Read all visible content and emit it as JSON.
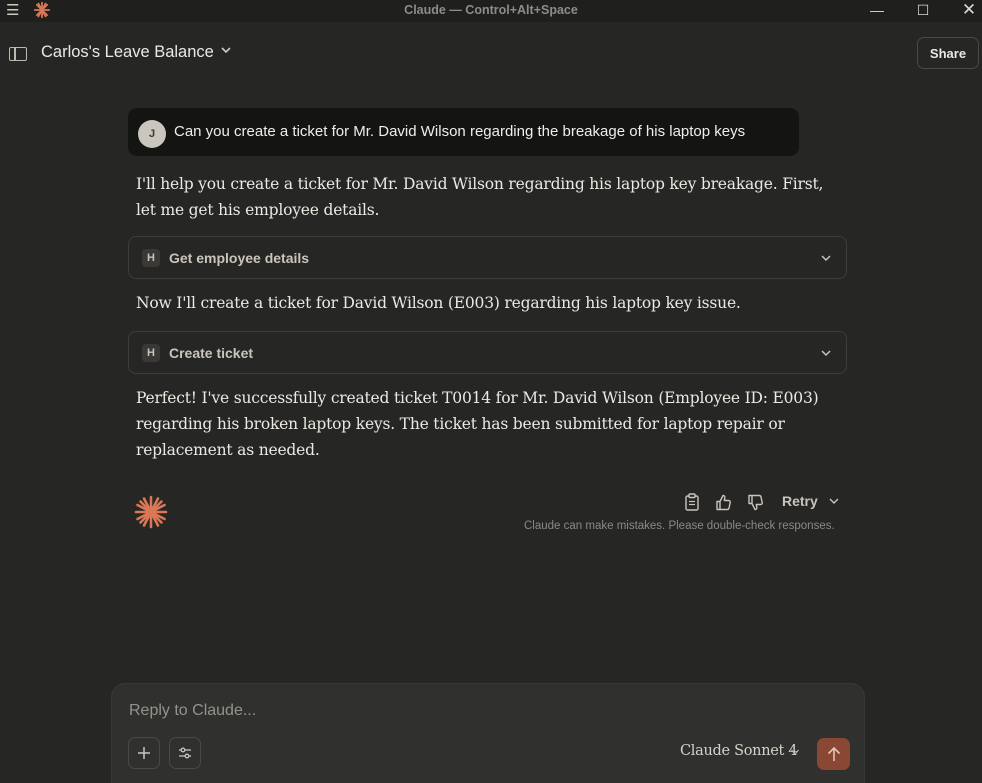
{
  "window": {
    "title": "Claude — Control+Alt+Space",
    "menu_icon": "hamburger-icon",
    "logo_icon": "claude-spark-icon",
    "controls": [
      "minimize-icon",
      "maximize-icon",
      "close-icon"
    ]
  },
  "header": {
    "chat_title": "Carlos's Leave Balance",
    "share_label": "Share"
  },
  "conversation": {
    "user_message": {
      "avatar_initial": "J",
      "text": "Can you create a ticket for Mr. David Wilson regarding the breakage of his laptop keys"
    },
    "assistant": {
      "paragraph1": "I'll help you create a ticket for Mr. David Wilson regarding his laptop key breakage. First, let me get his employee details.",
      "tool1": {
        "badge": "H",
        "label": "Get employee details"
      },
      "paragraph2": "Now I'll create a ticket for David Wilson (E003) regarding his laptop key issue.",
      "tool2": {
        "badge": "H",
        "label": "Create ticket"
      },
      "paragraph3": "Perfect! I've successfully created ticket T0014 for Mr. David Wilson (Employee ID: E003) regarding his broken laptop keys. The ticket has been submitted for laptop repair or replacement as needed."
    },
    "actions": {
      "retry_label": "Retry",
      "disclaimer": "Claude can make mistakes. Please double-check responses."
    }
  },
  "composer": {
    "placeholder": "Reply to Claude...",
    "value": "",
    "model": "Claude Sonnet 4"
  },
  "colors": {
    "background": "#262624",
    "accent": "#d97757",
    "send_button": "#8a4734"
  }
}
